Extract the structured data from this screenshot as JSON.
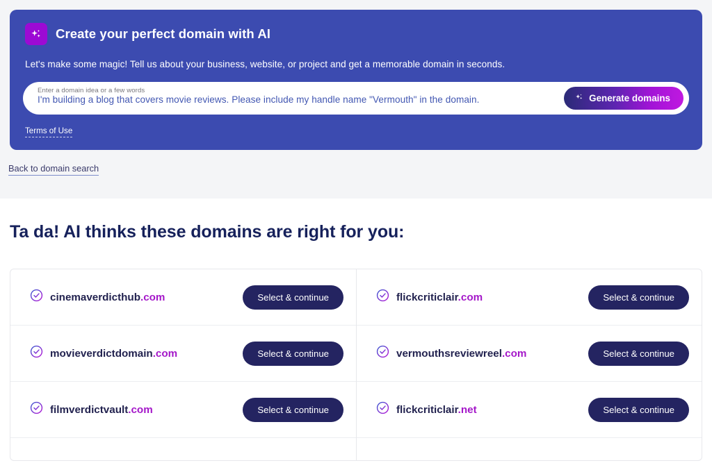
{
  "banner": {
    "icon": "sparkles-icon",
    "title": "Create your perfect domain with AI",
    "subtitle": "Let's make some magic! Tell us about your business, website, or project and get a memorable domain in seconds.",
    "input": {
      "label": "Enter a domain idea or a few words",
      "value": "I'm building a blog that covers movie reviews. Please include my handle name \"Vermouth\" in the domain.",
      "placeholder": "Enter a domain idea or a few words"
    },
    "generate_button": {
      "label": "Generate domains",
      "icon": "sparkles-icon"
    },
    "terms_link": "Terms of Use",
    "colors": {
      "background": "#3c4bb0",
      "badge": "#9c0ad4",
      "button_gradient_start": "#2b2b77",
      "button_gradient_end": "#c019e0"
    }
  },
  "back_link": "Back to domain search",
  "results": {
    "heading": "Ta da! AI thinks these domains are right for you:",
    "select_label": "Select & continue",
    "check_icon": "check-circle-icon",
    "columns": [
      {
        "domains": [
          {
            "sld": "cinemaverdicthub",
            "tld": ".com",
            "full": "cinemaverdicthub.com"
          },
          {
            "sld": "movieverdictdomain",
            "tld": ".com",
            "full": "movieverdictdomain.com"
          },
          {
            "sld": "filmverdictvault",
            "tld": ".com",
            "full": "filmverdictvault.com"
          }
        ]
      },
      {
        "domains": [
          {
            "sld": "flickcriticlair",
            "tld": ".com",
            "full": "flickcriticlair.com"
          },
          {
            "sld": "vermouthsreviewreel",
            "tld": ".com",
            "full": "vermouthsreviewreel.com"
          },
          {
            "sld": "flickcriticlair",
            "tld": ".net",
            "full": "flickcriticlair.net"
          }
        ]
      }
    ],
    "colors": {
      "tld": "#a417c9",
      "sld": "#22224f",
      "button": "#242461",
      "heading": "#16215b"
    }
  }
}
